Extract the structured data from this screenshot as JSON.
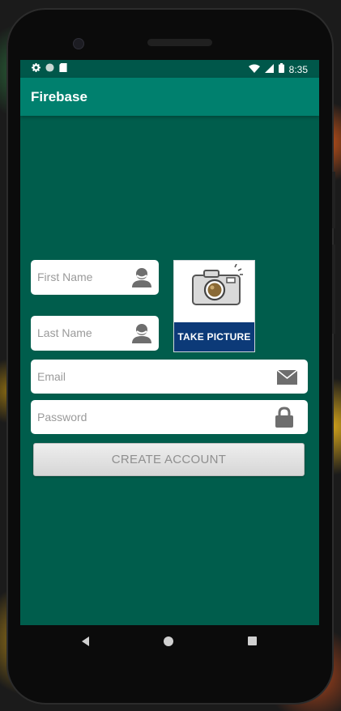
{
  "status_bar": {
    "time": "8:35",
    "icons_left": [
      "settings-icon",
      "circle-icon",
      "sd-card-icon"
    ],
    "icons_right": [
      "wifi-icon",
      "signal-icon",
      "battery-icon"
    ]
  },
  "app_bar": {
    "title": "Firebase"
  },
  "form": {
    "first_name": {
      "placeholder": "First Name",
      "icon": "person-icon"
    },
    "last_name": {
      "placeholder": "Last Name",
      "icon": "person-icon"
    },
    "email": {
      "placeholder": "Email",
      "icon": "mail-icon"
    },
    "password": {
      "placeholder": "Password",
      "icon": "lock-icon"
    },
    "take_picture": {
      "label": "TAKE PICTURE",
      "icon": "camera-icon"
    },
    "create_account": {
      "label": "CREATE ACCOUNT"
    }
  },
  "nav_bar": {
    "buttons": [
      "back",
      "home",
      "recents"
    ]
  },
  "colors": {
    "screen_bg": "#005d4c",
    "app_bar": "#00806e",
    "status_bar": "#00574a",
    "picture_label_bg": "#0c3a78"
  }
}
